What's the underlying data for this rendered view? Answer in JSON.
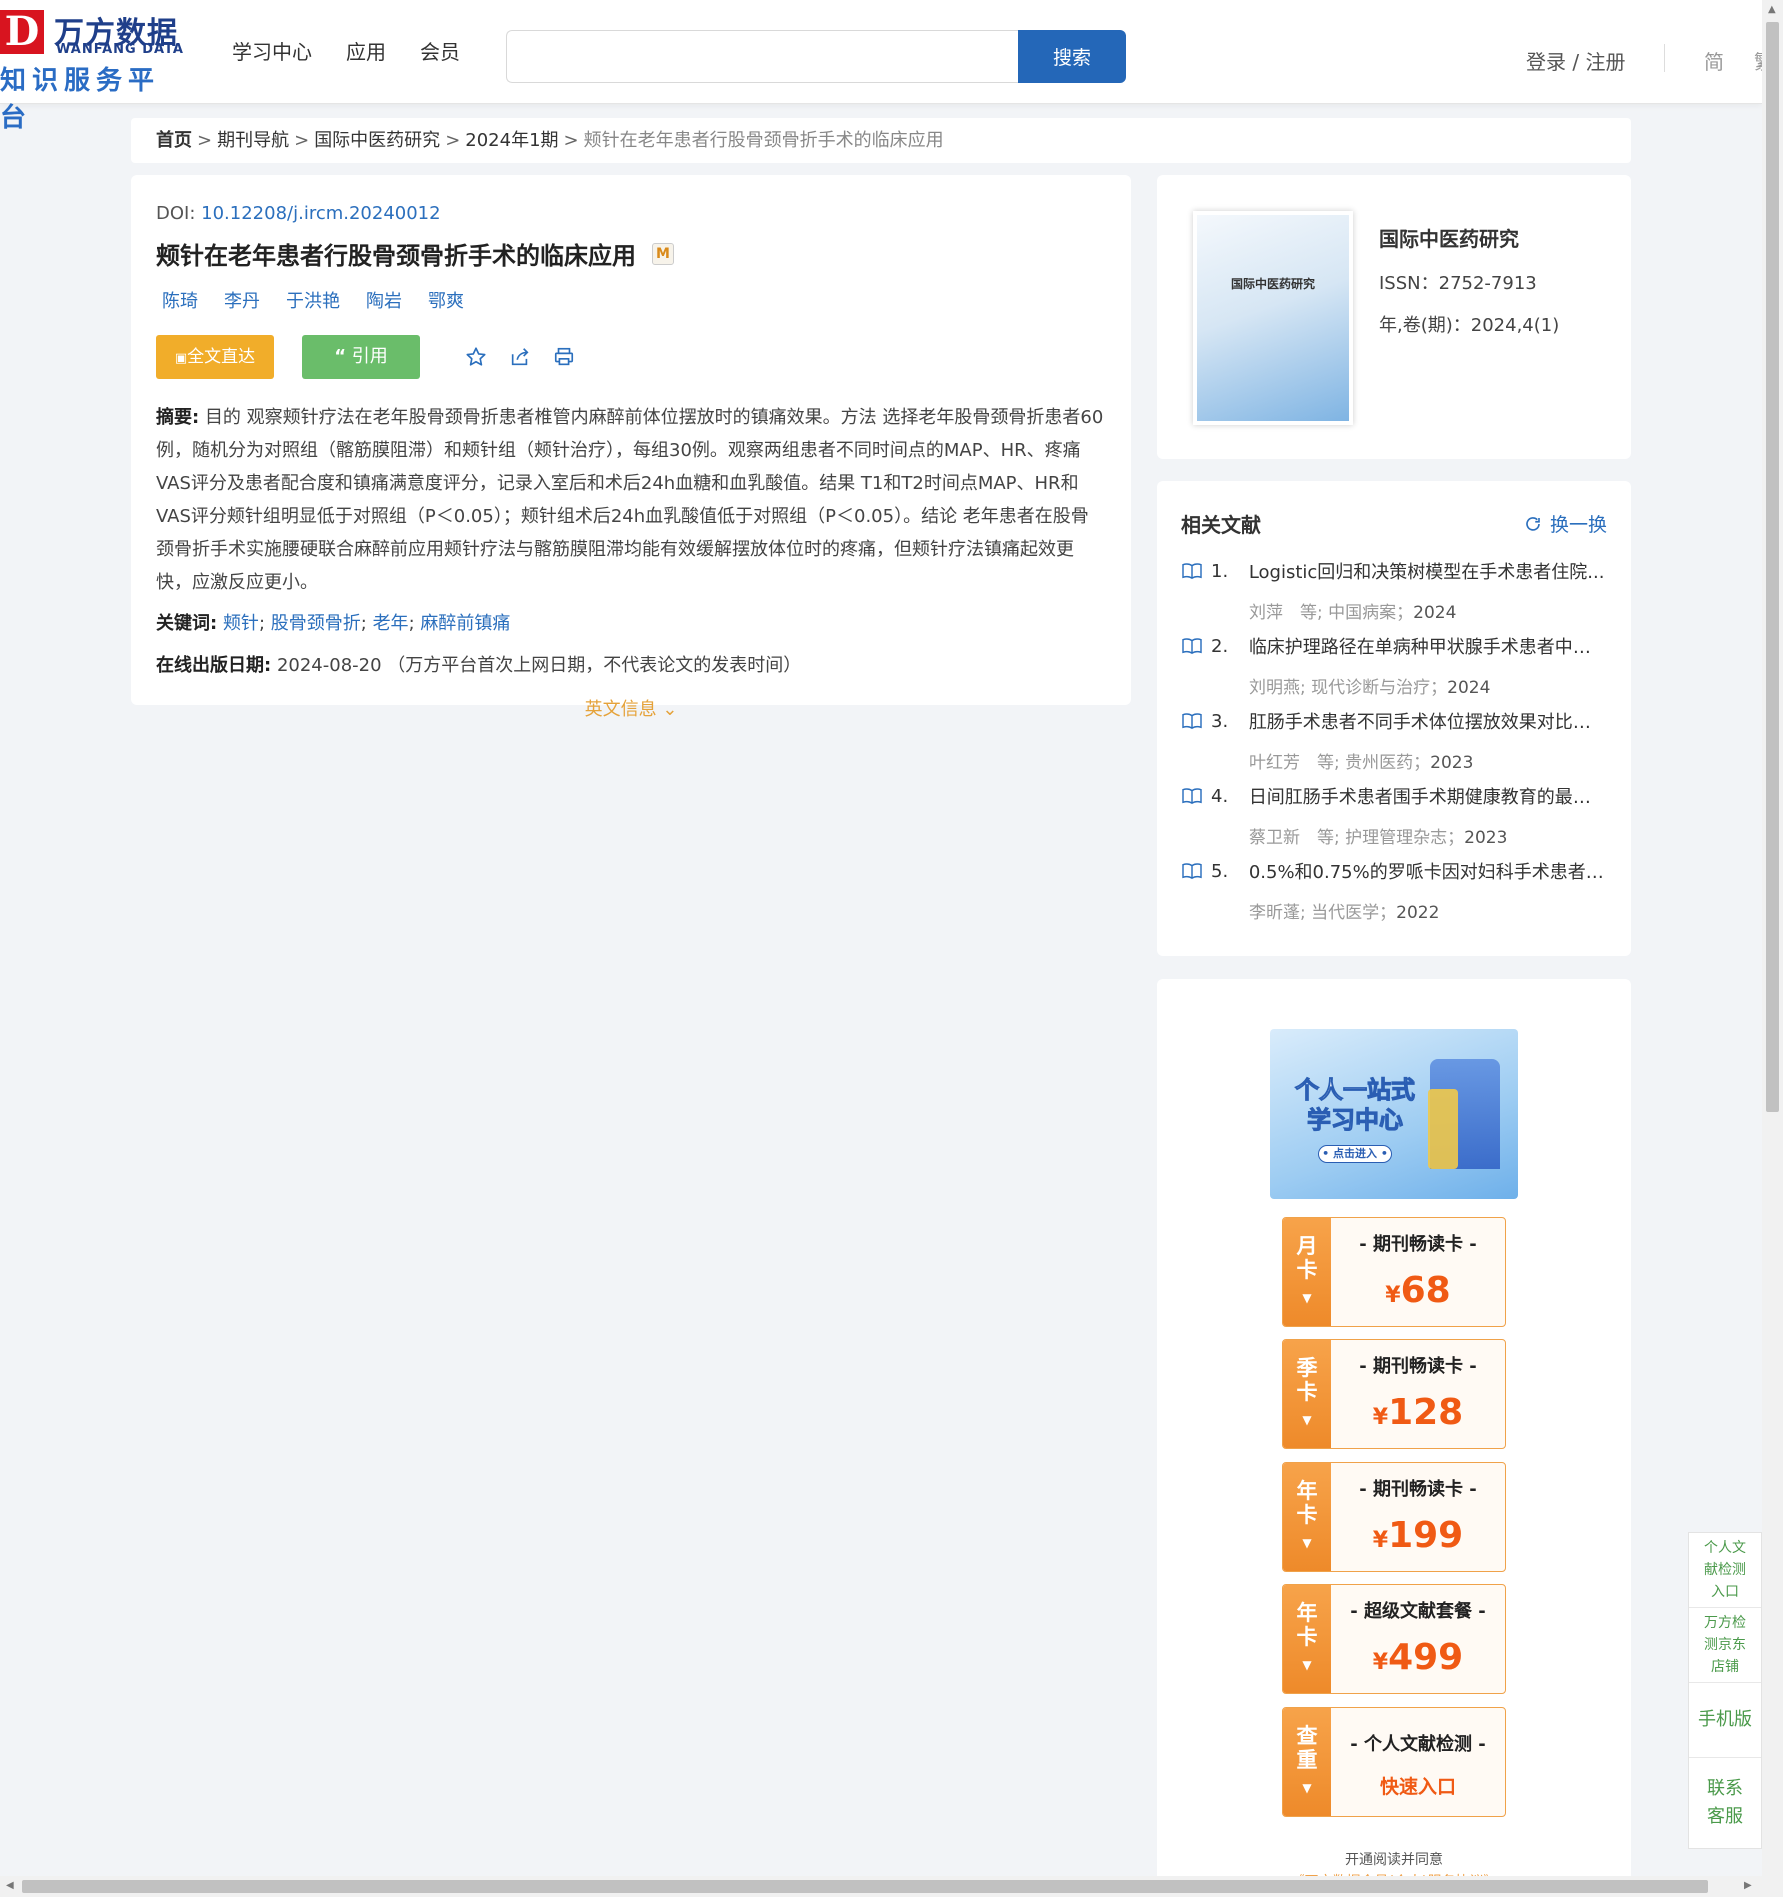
{
  "header": {
    "logo_mark": "D",
    "logo_cn": "万方数据",
    "logo_en": "WANFANG DATA",
    "logo_sub": "知识服务平台",
    "nav": [
      "学习中心",
      "应用",
      "会员"
    ],
    "search_value": "",
    "search_button": "搜索",
    "login": "登录 / 注册",
    "lang_simplified": "简",
    "lang_traditional": "繁"
  },
  "breadcrumb": {
    "home": "首页",
    "sep": ">",
    "items": [
      "期刊导航",
      "国际中医药研究",
      "2024年1期"
    ],
    "current": "颊针在老年患者行股骨颈骨折手术的临床应用"
  },
  "article": {
    "doi_label": "DOI:",
    "doi": "10.12208/j.ircm.20240012",
    "title": "颊针在老年患者行股骨颈骨折手术的临床应用",
    "badge": "M",
    "authors": [
      "陈琦",
      "李丹",
      "于洪艳",
      "陶岩",
      "鄂爽"
    ],
    "full_text_button": "全文直达",
    "cite_button": "引用",
    "abstract_label": "摘要:",
    "abstract": "目的 观察颊针疗法在老年股骨颈骨折患者椎管内麻醉前体位摆放时的镇痛效果。方法 选择老年股骨颈骨折患者60例，随机分为对照组（髂筋膜阻滞）和颊针组（颊针治疗），每组30例。观察两组患者不同时间点的MAP、HR、疼痛VAS评分及患者配合度和镇痛满意度评分，记录入室后和术后24h血糖和血乳酸值。结果 T1和T2时间点MAP、HR和VAS评分颊针组明显低于对照组（P＜0.05）；颊针组术后24h血乳酸值低于对照组（P＜0.05）。结论 老年患者在股骨颈骨折手术实施腰硬联合麻醉前应用颊针疗法与髂筋膜阻滞均能有效缓解摆放体位时的疼痛，但颊针疗法镇痛起效更快，应激反应更小。",
    "keywords_label": "关键词:",
    "keywords": [
      "颊针",
      "股骨颈骨折",
      "老年",
      "麻醉前镇痛"
    ],
    "keyword_sep": ";",
    "pubdate_label": "在线出版日期:",
    "pubdate": "2024-08-20",
    "pubdate_note": "（万方平台首次上网日期，不代表论文的发表时间）",
    "english_info": "英文信息"
  },
  "journal": {
    "cover_title": "国际中医药研究",
    "name": "国际中医药研究",
    "issn": "ISSN：2752-7913",
    "volume": "年,卷(期)：2024,4(1)"
  },
  "related": {
    "title": "相关文献",
    "refresh": "换一换",
    "items": [
      {
        "num": "1.",
        "title": "Logistic回归和决策树模型在手术患者住院...",
        "authors": "刘萍　等;",
        "source": "中国病案；",
        "year": "2024"
      },
      {
        "num": "2.",
        "title": "临床护理路径在单病种甲状腺手术患者中的...",
        "authors": "刘明燕;",
        "source": "现代诊断与治疗；",
        "year": "2024"
      },
      {
        "num": "3.",
        "title": "肛肠手术患者不同手术体位摆放效果对比分析",
        "authors": "叶红芳　等;",
        "source": "贵州医药；",
        "year": "2023"
      },
      {
        "num": "4.",
        "title": "日间肛肠手术患者围手术期健康教育的最佳...",
        "authors": "蔡卫新　等;",
        "source": "护理管理杂志；",
        "year": "2023"
      },
      {
        "num": "5.",
        "title": "0.5%和0.75%的罗哌卡因对妇科手术患者的...",
        "authors": "李昕蓬;",
        "source": "当代医学；",
        "year": "2022"
      }
    ]
  },
  "promo": {
    "banner_line1": "个人一站式",
    "banner_line2": "学习中心",
    "banner_button": "• 点击进入 •",
    "currency": "¥",
    "cards": [
      {
        "tab": [
          "月",
          "卡"
        ],
        "name": "- 期刊畅读卡 -",
        "price": "68"
      },
      {
        "tab": [
          "季",
          "卡"
        ],
        "name": "- 期刊畅读卡 -",
        "price": "128"
      },
      {
        "tab": [
          "年",
          "卡"
        ],
        "name": "- 期刊畅读卡 -",
        "price": "199"
      },
      {
        "tab": [
          "年",
          "卡"
        ],
        "name": "- 超级文献套餐 -",
        "price": "499"
      },
      {
        "tab": [
          "查",
          "重"
        ],
        "name": "- 个人文献检测 -",
        "quick": "快速入口"
      }
    ],
    "note": "开通阅读并同意",
    "agreement": "《万方数据会员(个人)服务协议》"
  },
  "side": {
    "items": [
      "个人文献检测入口",
      "万方检测京东店铺",
      "手机版",
      "联系客服"
    ]
  },
  "colors": {
    "primary": "#2467b8",
    "link": "#2b6fbd",
    "orange": "#f1ad2a",
    "green": "#6abd6a",
    "price": "#f05a14"
  }
}
